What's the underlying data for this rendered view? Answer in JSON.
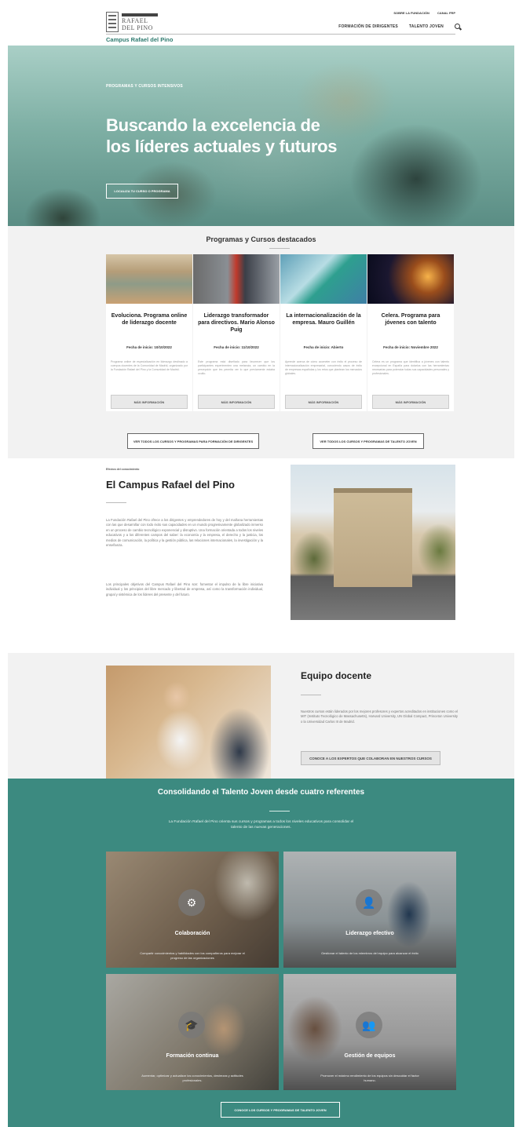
{
  "header": {
    "logo_line1": "RAFAEL",
    "logo_line2": "DEL PINO",
    "top_links": [
      "SOBRE LA FUNDACIÓN",
      "CANAL FRP"
    ],
    "main_links": [
      "FORMACIÓN DE DIRIGENTES",
      "TALENTO JOVEN"
    ],
    "campus_title": "Campus Rafael del Pino"
  },
  "hero": {
    "subtitle": "PROGRAMAS Y CURSOS INTENSIVOS",
    "title": "Buscando la excelencia de los líderes actuales y futuros",
    "cta": "LOCALIZA TU CURSO O PROGRAMA"
  },
  "programs": {
    "title": "Programas y Cursos destacados",
    "cards": [
      {
        "title": "Evoluciona. Programa online de liderazgo docente",
        "date": "Fecha de inicio: 10/10/2022",
        "text": "Programa online de especialización en liderazgo destinado a cuerpos docentes de la Comunidad de Madrid, organizado por la Fundación Rafael del Pino y la Comunidad de Madrid.",
        "button": "MÁS INFORMACIÓN"
      },
      {
        "title": "Liderazgo transformador para directivos. Mario Alonso Puig",
        "date": "Fecha de inicio: 11/10/2022",
        "text": "Este programa está diseñado para favorecer que los participantes experimenten una metanoia, un cambio en la percepción que les permita ver lo que previamente estaba oculto.",
        "button": "MÁS INFORMACIÓN"
      },
      {
        "title": "La internacionalización de la empresa. Mauro Guillén",
        "date": "Fecha de inicio: Abierto",
        "text": "Aprende acerca de cómo acometer con éxito el proceso de internacionalización empresarial, conociendo casos de éxito de empresas españolas y los retos que plantean los mercados globales.",
        "button": "MÁS INFORMACIÓN"
      },
      {
        "title": "Celera. Programa para jóvenes con talento",
        "date": "Fecha de inicio: Noviembre 2022",
        "text": "Celera es un programa que identifica a jóvenes con talento excepcional en España para dotarlos con las herramientas necesarias para potenciar todas sus capacidades personales y profesionales.",
        "button": "MÁS INFORMACIÓN"
      }
    ],
    "btn_left": "VER TODOS LOS CURSOS Y PROGRAMAS PARA FORMACIÓN DE DIRIGENTES",
    "btn_right": "VER TODOS LOS CURSOS Y PROGRAMAS DE TALENTO JOVEN"
  },
  "campus": {
    "small": "Efectos del conocimiento",
    "title": "El Campus Rafael del Pino",
    "p1": "La Fundación Rafael del Pino ofrece a los dirigentes y emprendedores de hoy y del mañana herramientas con las que desarrollar con todo éxito sus capacidades en un mundo progresivamente globalizado inmerso en un proceso de cambio tecnológico exponencial y disruptivo. Una formación orientada a todos los niveles educativos y a los diferentes campos del saber: la economía y la empresa, el derecho y la justicia, los medios de comunicación, la política y la gestión pública, las relaciones internacionales, la investigación y la enseñanza.",
    "p2": "Los principales objetivos del Campus Rafael del Pino son: fomentar el impulso de la libre iniciativa individual y los principios del libre mercado y libertad de empresa, así como la transformación individual, grupal y sistémica de los líderes del presente y del futuro."
  },
  "equipo": {
    "title": "Equipo docente",
    "text": "Nuestros cursos están liderados por los mejores profesores y expertos acreditados en instituciones como el MIT (Instituto Tecnológico de Massachusetts), Harvard University, UN Global Compact, Princeton University o la Universidad Carlos III de Madrid.",
    "button": "CONOCE A LOS EXPERTOS QUE COLABORAN EN NUESTROS CURSOS"
  },
  "talento": {
    "title": "Consolidando el Talento Joven desde cuatro referentes",
    "text": "La Fundación Rafael del Pino orienta sus cursos y programas a todos los niveles educativos para consolidar el talento de las nuevas generaciones.",
    "tiles": [
      {
        "title": "Colaboración",
        "desc": "Compartir conocimientos y habilidades con los compañeros para mejorar el progreso de las organizaciones",
        "icon": "gears-icon"
      },
      {
        "title": "Liderazgo efectivo",
        "desc": "Gestionar el talento de los miembros del equipo para alcanzar el éxito",
        "icon": "user-plus-icon"
      },
      {
        "title": "Formación continua",
        "desc": "Aumentar, optimizar y actualizar los conocimientos, destrezas y actitudes profesionales.",
        "icon": "graduate-icon"
      },
      {
        "title": "Gestión de equipos",
        "desc": "Promover el máximo rendimiento de los equipos sin descuidar el factor humano.",
        "icon": "team-icon"
      }
    ],
    "button": "CONOCE LOS CURSOS Y PROGRAMAS DE TALENTO JOVEN"
  }
}
